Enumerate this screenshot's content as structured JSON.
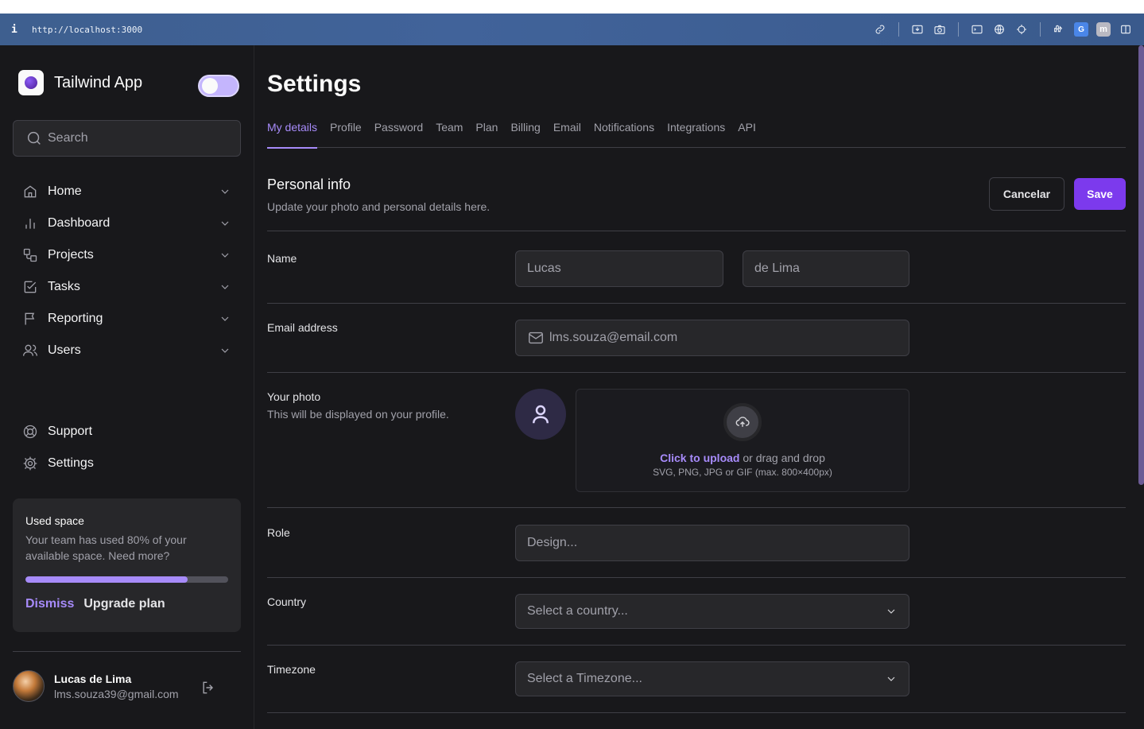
{
  "browser": {
    "info_icon": "i",
    "url": "http://localhost:3000",
    "tools": [
      "link-icon",
      "download-icon",
      "camera-icon",
      "terminal-icon",
      "globe-icon",
      "crosshair-icon",
      "extensions-icon",
      "translate-icon",
      "m-extension-icon",
      "sidebar-icon"
    ],
    "translate_label": "G",
    "m_label": "m"
  },
  "sidebar": {
    "brand": "Tailwind App",
    "toggle_on": true,
    "search_placeholder": "Search",
    "nav": [
      {
        "label": "Home",
        "icon": "home-icon"
      },
      {
        "label": "Dashboard",
        "icon": "bar-chart-icon"
      },
      {
        "label": "Projects",
        "icon": "projects-icon"
      },
      {
        "label": "Tasks",
        "icon": "check-square-icon"
      },
      {
        "label": "Reporting",
        "icon": "flag-icon"
      },
      {
        "label": "Users",
        "icon": "users-icon"
      }
    ],
    "nav_secondary": [
      {
        "label": "Support",
        "icon": "life-buoy-icon"
      },
      {
        "label": "Settings",
        "icon": "gear-icon"
      }
    ],
    "usage": {
      "title": "Used space",
      "text": "Your team has used 80% of your available space. Need more?",
      "percent": 80,
      "dismiss": "Dismiss",
      "upgrade": "Upgrade plan"
    },
    "user": {
      "name": "Lucas de Lima",
      "email": "lms.souza39@gmail.com"
    }
  },
  "main": {
    "title": "Settings",
    "tabs": [
      "My details",
      "Profile",
      "Password",
      "Team",
      "Plan",
      "Billing",
      "Email",
      "Notifications",
      "Integrations",
      "API"
    ],
    "active_tab": "My details",
    "section": {
      "title": "Personal info",
      "subtitle": "Update your photo and personal details here.",
      "cancel": "Cancelar",
      "save": "Save"
    },
    "fields": {
      "name_label": "Name",
      "first_name": "Lucas",
      "last_name": "de Lima",
      "email_label": "Email address",
      "email": "lms.souza@email.com",
      "photo_label": "Your photo",
      "photo_hint": "This will be displayed on your profile.",
      "upload_link": "Click to upload",
      "upload_rest": " or drag and drop",
      "upload_formats": "SVG, PNG, JPG or GIF (max. 800×400px)",
      "role_label": "Role",
      "role_placeholder": "Design...",
      "country_label": "Country",
      "country_placeholder": "Select a country...",
      "timezone_label": "Timezone",
      "timezone_placeholder": "Select a Timezone..."
    }
  },
  "colors": {
    "accent": "#7c3aed",
    "accent_light": "#a78bfa",
    "background": "#18181b",
    "surface": "#27272a",
    "border": "#3f3f46"
  }
}
